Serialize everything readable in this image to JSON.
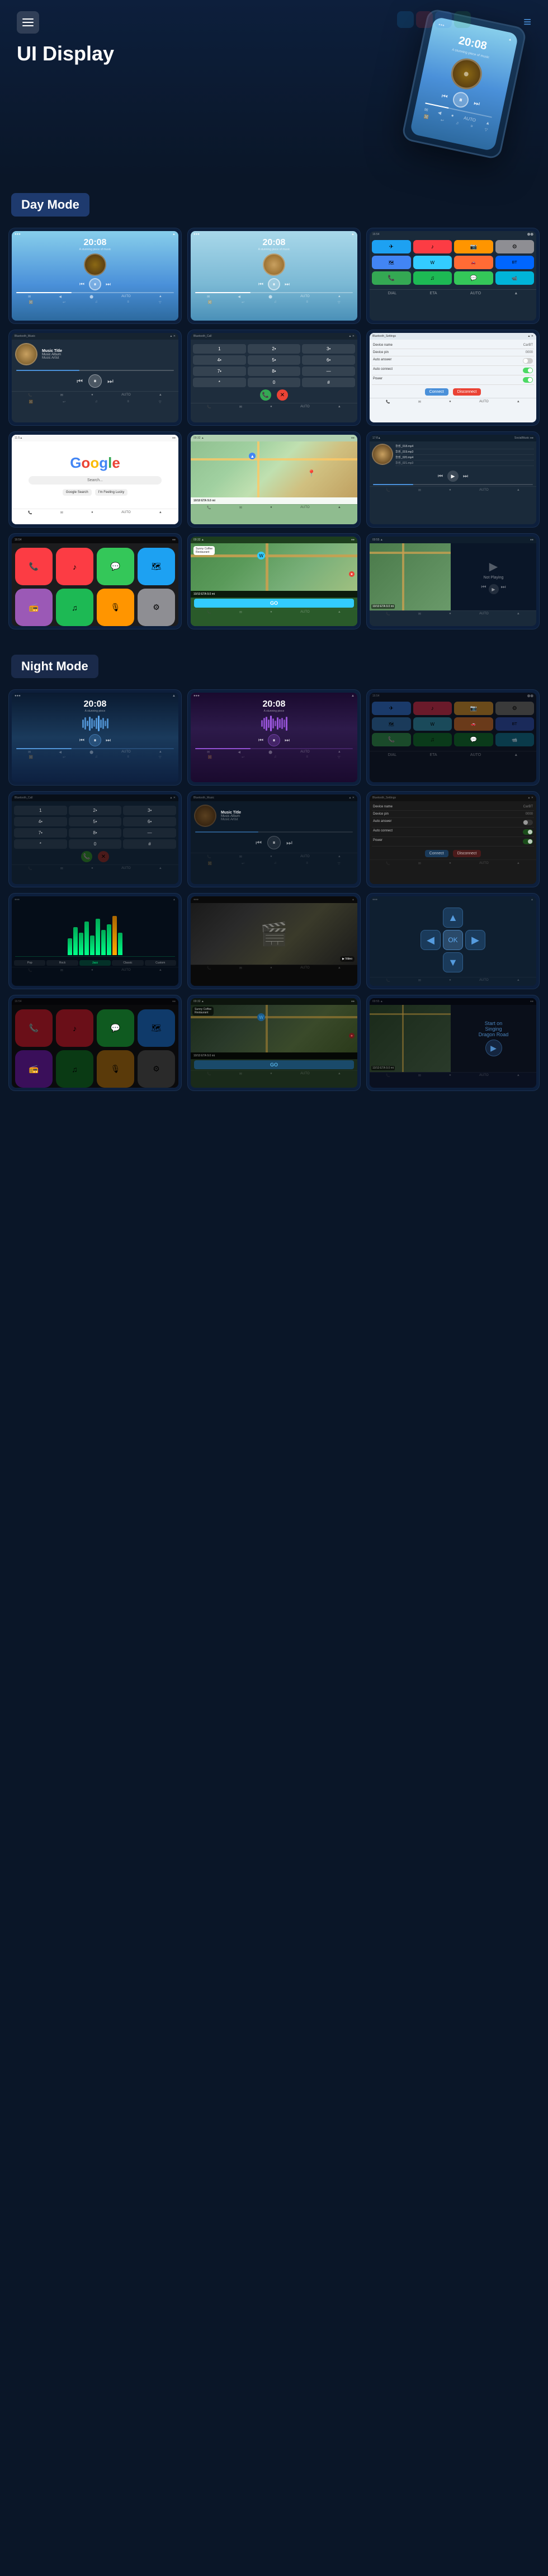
{
  "header": {
    "menu_label": "Menu",
    "nav_label": "Navigation",
    "title": "UI Display"
  },
  "day_mode": {
    "label": "Day Mode",
    "screens": [
      {
        "id": "day-music-1",
        "type": "music_player",
        "time": "20:08",
        "subtitle": "A stunning piece of music",
        "theme": "day_blue"
      },
      {
        "id": "day-music-2",
        "type": "music_player",
        "time": "20:08",
        "subtitle": "A stunning piece of music",
        "theme": "day_light"
      },
      {
        "id": "day-apps",
        "type": "app_grid",
        "theme": "day_dark"
      },
      {
        "id": "day-bt-music",
        "type": "bluetooth_music",
        "title": "Bluetooth_Music",
        "track": "Music Title",
        "album": "Music Album",
        "artist": "Music Artist"
      },
      {
        "id": "day-bt-call",
        "type": "bluetooth_call",
        "title": "Bluetooth_Call"
      },
      {
        "id": "day-bt-settings",
        "type": "bluetooth_settings",
        "title": "Bluetooth_Settings",
        "device_name": "CarBT",
        "device_pin": "0000"
      },
      {
        "id": "day-google",
        "type": "google",
        "text": "Google"
      },
      {
        "id": "day-map",
        "type": "map_nav",
        "eta": "10/10 ETA  9.0 mi"
      },
      {
        "id": "day-local-music",
        "type": "local_music",
        "title": "SocialMusic",
        "files": [
          "华乐_018.mp4",
          "华乐_019.mp3",
          "华乐_020.mp4"
        ]
      },
      {
        "id": "day-carplay",
        "type": "carplay"
      },
      {
        "id": "day-waze",
        "type": "waze_map",
        "restaurant": "Sunny Coffee Restaurant",
        "eta": "10/10 ETA  9.0 mi",
        "go": "GO"
      },
      {
        "id": "day-not-playing",
        "type": "not_playing",
        "eta": "10/10 ETA  9.0 mi",
        "text": "Not Playing"
      }
    ]
  },
  "night_mode": {
    "label": "Night Mode",
    "screens": [
      {
        "id": "night-music-1",
        "type": "music_player",
        "time": "20:08",
        "theme": "night_dark"
      },
      {
        "id": "night-music-2",
        "type": "music_player",
        "time": "20:08",
        "theme": "night_purple"
      },
      {
        "id": "night-apps",
        "type": "app_grid",
        "theme": "night_dark"
      },
      {
        "id": "night-bt-call",
        "type": "bluetooth_call",
        "title": "Bluetooth_Call",
        "theme": "night"
      },
      {
        "id": "night-bt-music",
        "type": "bluetooth_music",
        "title": "Bluetooth_Music",
        "track": "Music Title",
        "album": "Music Album",
        "artist": "Music Artist",
        "theme": "night"
      },
      {
        "id": "night-bt-settings",
        "type": "bluetooth_settings",
        "title": "Bluetooth_Settings",
        "device_name": "CarBT",
        "device_pin": "0000",
        "theme": "night"
      },
      {
        "id": "night-eq",
        "type": "equalizer",
        "theme": "night"
      },
      {
        "id": "night-video",
        "type": "video",
        "theme": "night"
      },
      {
        "id": "night-nav-controls",
        "type": "nav_controls",
        "theme": "night"
      },
      {
        "id": "night-carplay",
        "type": "carplay",
        "theme": "night"
      },
      {
        "id": "night-waze",
        "type": "waze_map",
        "restaurant": "Sunny Coffee Restaurant",
        "eta": "10/10 ETA  9.0 mi",
        "go": "GO",
        "theme": "night"
      },
      {
        "id": "night-not-playing",
        "type": "not_playing",
        "eta": "10/10 ETA  9.0 mi",
        "text": "Start on Singing Dragon Road",
        "theme": "night"
      }
    ]
  },
  "music_info": {
    "title": "Music Title",
    "album": "Music Album",
    "artist": "Music Artist"
  },
  "app_icons": {
    "telegram": "✈",
    "music": "♪",
    "photos": "🖼",
    "settings": "⚙",
    "maps": "🗺",
    "waze": "W",
    "carcar": "🚗",
    "bt": "BT",
    "phone": "📞",
    "spotify": "♫",
    "messages": "💬",
    "facetime": "📹"
  },
  "colors": {
    "accent_blue": "#1e3a6e",
    "bg_dark": "#0a1628",
    "bg_card": "#0d1f3c",
    "border": "#1a3050",
    "day_mode_bg": "#87ceeb",
    "night_mode_bg": "#0a1020"
  }
}
